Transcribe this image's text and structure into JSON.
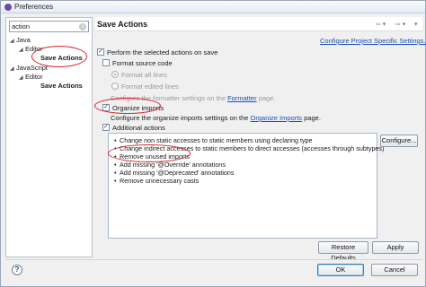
{
  "window": {
    "title": "Preferences"
  },
  "filter": {
    "value": "action",
    "clear_label": "x"
  },
  "tree": [
    {
      "label": "Java"
    },
    {
      "label": "Editor"
    },
    {
      "label": "Save Actions"
    },
    {
      "label": "JavaScript"
    },
    {
      "label": "Editor"
    },
    {
      "label": "Save Actions"
    }
  ],
  "page": {
    "title": "Save Actions",
    "configure_link": "Configure Project Specific Settings..."
  },
  "options": {
    "perform": "Perform the selected actions on save",
    "format_source": "Format source code",
    "format_all": "Format all lines",
    "format_edited": "Format edited lines",
    "formatter_hint": "Configure the formatter settings on the",
    "formatter_link": "Formatter",
    "formatter_suffix": "page.",
    "organize": "Organize imports",
    "organize_hint": "Configure the organize imports settings on the",
    "organize_link": "Organize Imports",
    "organize_suffix": "page.",
    "additional": "Additional actions"
  },
  "actions": [
    "Change non static accesses to static members using declaring type",
    "Change indirect accesses to static members to direct accesses (accesses through subtypes)",
    "Remove unused imports",
    "Add missing '@Override' annotations",
    "Add missing '@Deprecated' annotations",
    "Remove unnecessary casts"
  ],
  "buttons": {
    "configure": "Configure...",
    "restore": "Restore Defaults",
    "apply": "Apply",
    "ok": "OK",
    "cancel": "Cancel",
    "help": "?"
  },
  "highlight_color": "#d5232b"
}
